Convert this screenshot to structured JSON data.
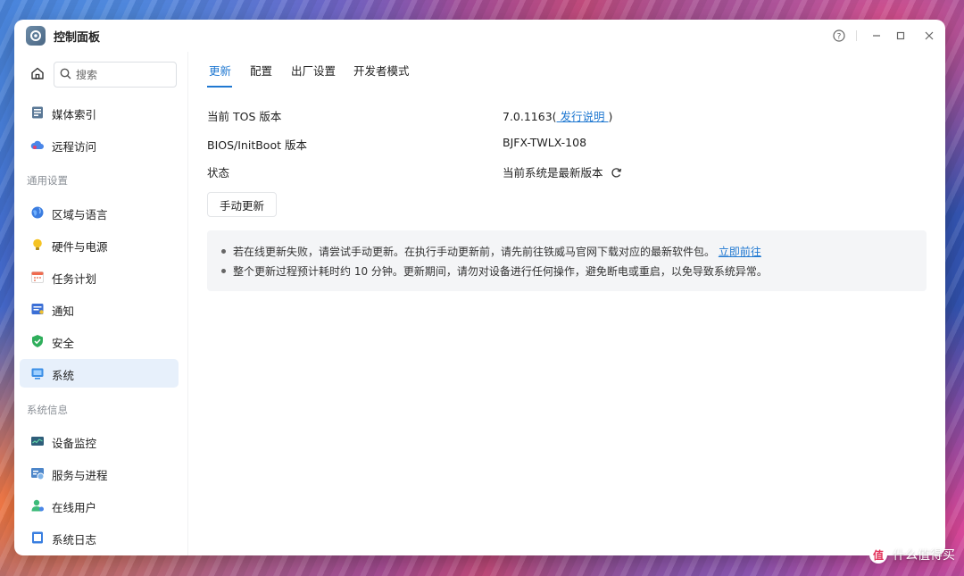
{
  "window": {
    "title": "控制面板"
  },
  "sidebar": {
    "search_placeholder": "搜索",
    "top_items": [
      {
        "label": "媒体索引",
        "icon": "media-index-icon"
      },
      {
        "label": "远程访问",
        "icon": "cloud-icon"
      }
    ],
    "sections": [
      {
        "title": "通用设置",
        "items": [
          {
            "label": "区域与语言",
            "icon": "globe-icon"
          },
          {
            "label": "硬件与电源",
            "icon": "lightbulb-icon"
          },
          {
            "label": "任务计划",
            "icon": "calendar-icon"
          },
          {
            "label": "通知",
            "icon": "notification-icon"
          },
          {
            "label": "安全",
            "icon": "shield-icon"
          },
          {
            "label": "系统",
            "icon": "monitor-icon",
            "active": true
          }
        ]
      },
      {
        "title": "系统信息",
        "items": [
          {
            "label": "设备监控",
            "icon": "device-monitor-icon"
          },
          {
            "label": "服务与进程",
            "icon": "services-icon"
          },
          {
            "label": "在线用户",
            "icon": "user-icon"
          },
          {
            "label": "系统日志",
            "icon": "log-icon"
          }
        ]
      }
    ]
  },
  "tabs": [
    {
      "label": "更新",
      "active": true
    },
    {
      "label": "配置"
    },
    {
      "label": "出厂设置"
    },
    {
      "label": "开发者模式"
    }
  ],
  "info": {
    "tos_label": "当前 TOS 版本",
    "tos_version": "7.0.1163(",
    "tos_release_link": " 发行说明 ",
    "tos_close_paren": ")",
    "bios_label": "BIOS/InitBoot 版本",
    "bios_value": "BJFX-TWLX-108",
    "status_label": "状态",
    "status_value": "当前系统是最新版本"
  },
  "manual_update_button": "手动更新",
  "notice": {
    "line1": "若在线更新失败，请尝试手动更新。在执行手动更新前，请先前往铁威马官网下载对应的最新软件包。",
    "line1_link": "立即前往",
    "line2": "整个更新过程预计耗时约 10 分钟。更新期间，请勿对设备进行任何操作，避免断电或重启，以免导致系统异常。"
  },
  "watermark": {
    "icon_text": "值",
    "text": "什么值得买"
  },
  "colors": {
    "accent": "#1f78d1",
    "active_bg": "#e7f0fb"
  }
}
